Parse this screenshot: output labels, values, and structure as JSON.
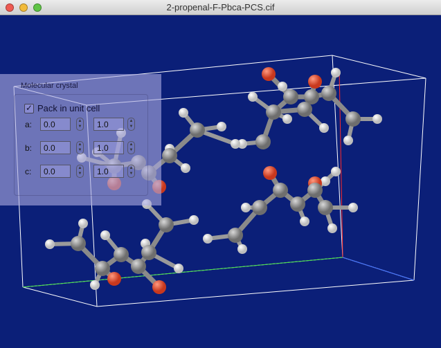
{
  "window": {
    "title": "2-propenal-F-Pbca-PCS.cif"
  },
  "panel": {
    "title": "Molecular crystal",
    "pack_label": "Pack in unit cell",
    "pack_checked": true,
    "rows": [
      {
        "label": "a:",
        "min": "0.0",
        "max": "1.0"
      },
      {
        "label": "b:",
        "min": "0.0",
        "max": "1.0"
      },
      {
        "label": "c:",
        "min": "0.0",
        "max": "1.0"
      }
    ]
  },
  "colors": {
    "background": "#0b1f78",
    "carbon": "#6e6e6e",
    "oxygen": "#c8381e",
    "hydrogen": "#f2f2f2",
    "axis_a": "#ff2a2a",
    "axis_b": "#3ee03e",
    "axis_c": "#3a6cff"
  }
}
